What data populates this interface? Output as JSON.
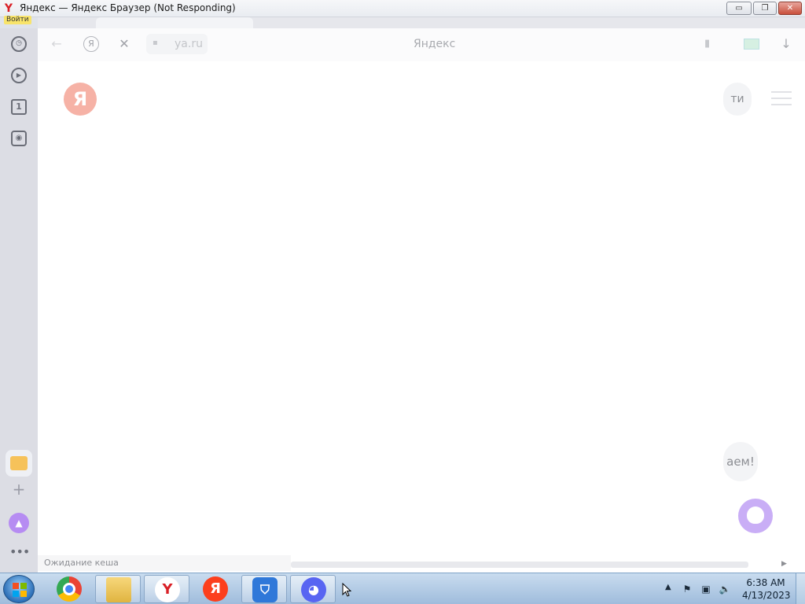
{
  "window": {
    "title": "Яндекс — Яндекс Браузер (Not Responding)",
    "signin_badge": "Войти",
    "minimize": "▭",
    "maximize": "❐",
    "close": "✕"
  },
  "sidebar": {
    "items": [
      {
        "icon": "clock-icon",
        "glyph": "◷"
      },
      {
        "icon": "play-icon",
        "glyph": "▶"
      },
      {
        "icon": "tab-number-icon",
        "glyph": "1"
      },
      {
        "icon": "screenshot-icon",
        "glyph": "◉"
      }
    ],
    "add": "+",
    "alice": "▲",
    "more": "•••"
  },
  "toolbar": {
    "back": "←",
    "yandex_icon": "Я",
    "stop": "✕",
    "lock": "🔒",
    "url": "ya.ru",
    "page_title": "Яндекс",
    "bookmark": "▮",
    "download": "↓"
  },
  "page": {
    "logo": "Я",
    "signin_partial": "ти",
    "hint_partial": "аем!"
  },
  "statusbar": {
    "text": "Ожидание кеша"
  },
  "taskbar": {
    "apps": [
      {
        "name": "chrome",
        "label": ""
      },
      {
        "name": "explorer",
        "label": ""
      },
      {
        "name": "yandex-browser",
        "label": "Y"
      },
      {
        "name": "yandex",
        "label": "Я"
      },
      {
        "name": "shield-app",
        "label": "⛉"
      },
      {
        "name": "discord",
        "label": "◕"
      }
    ],
    "tray": {
      "arrow": "▲",
      "time": "6:38 AM",
      "date": "4/13/2023"
    }
  },
  "colors": {
    "yandex_red": "#fc3f1d",
    "alice_purple": "#b68cf2",
    "taskbar_blue": "#9fbcdc"
  }
}
